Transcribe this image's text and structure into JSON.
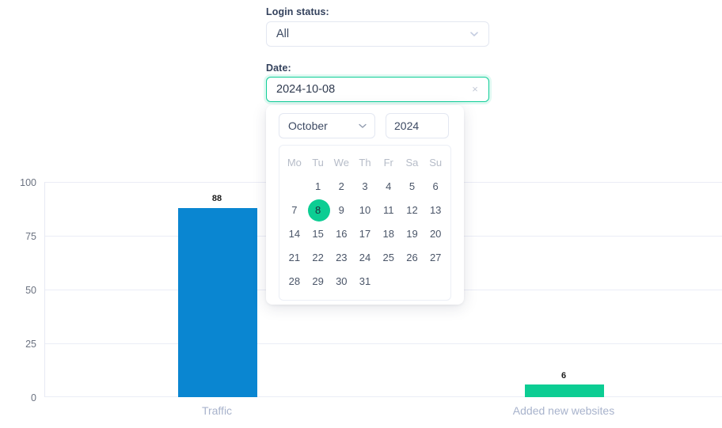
{
  "filters": {
    "login_status": {
      "label": "Login status:",
      "value": "All",
      "chevron_icon": "chevron-down-icon"
    },
    "date": {
      "label": "Date:",
      "value": "2024-10-08",
      "clear_icon": "close-icon",
      "clear_glyph": "×"
    }
  },
  "calendar": {
    "month": "October",
    "month_chevron_icon": "chevron-down-icon",
    "year": "2024",
    "weekdays": [
      "Mo",
      "Tu",
      "We",
      "Th",
      "Fr",
      "Sa",
      "Su"
    ],
    "selected_day": "8",
    "weeks": [
      [
        "",
        "1",
        "2",
        "3",
        "4",
        "5",
        "6"
      ],
      [
        "7",
        "8",
        "9",
        "10",
        "11",
        "12",
        "13"
      ],
      [
        "14",
        "15",
        "16",
        "17",
        "18",
        "19",
        "20"
      ],
      [
        "21",
        "22",
        "23",
        "24",
        "25",
        "26",
        "27"
      ],
      [
        "28",
        "29",
        "30",
        "31",
        "",
        "",
        ""
      ]
    ],
    "selected_color": "#0ccd93"
  },
  "chart_data": {
    "type": "bar",
    "title": "",
    "xlabel": "",
    "ylabel": "",
    "categories": [
      "Traffic",
      "Added new websites"
    ],
    "values": [
      88,
      6
    ],
    "value_labels": [
      "88",
      "6"
    ],
    "colors": [
      "#0a86d1",
      "#0ccd93"
    ],
    "ylim": [
      0,
      100
    ],
    "yticks": [
      "100",
      "75",
      "50",
      "25",
      "0"
    ],
    "grid": true,
    "legend": "none"
  }
}
